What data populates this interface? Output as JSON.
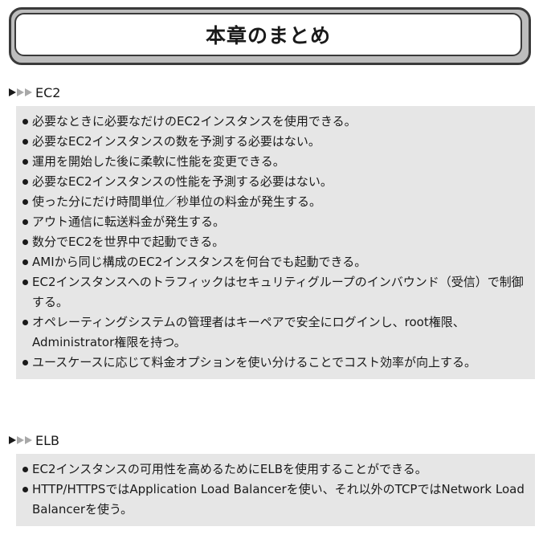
{
  "title": "本章のまとめ",
  "sections": [
    {
      "heading": "EC2",
      "items": [
        "必要なときに必要なだけのEC2インスタンスを使用できる。",
        "必要なEC2インスタンスの数を予測する必要はない。",
        "運用を開始した後に柔軟に性能を変更できる。",
        "必要なEC2インスタンスの性能を予測する必要はない。",
        "使った分にだけ時間単位／秒単位の料金が発生する。",
        "アウト通信に転送料金が発生する。",
        "数分でEC2を世界中で起動できる。",
        "AMIから同じ構成のEC2インスタンスを何台でも起動できる。",
        "EC2インスタンスへのトラフィックはセキュリティグループのインバウンド（受信）で制御する。",
        "オペレーティングシステムの管理者はキーペアで安全にログインし、root権限、Administrator権限を持つ。",
        "ユースケースに応じて料金オプションを使い分けることでコスト効率が向上する。"
      ]
    },
    {
      "heading": "ELB",
      "items": [
        "EC2インスタンスの可用性を高めるためにELBを使用することができる。",
        "HTTP/HTTPSではApplication Load Balancerを使い、それ以外のTCPではNetwork Load Balancerを使う。"
      ]
    }
  ]
}
